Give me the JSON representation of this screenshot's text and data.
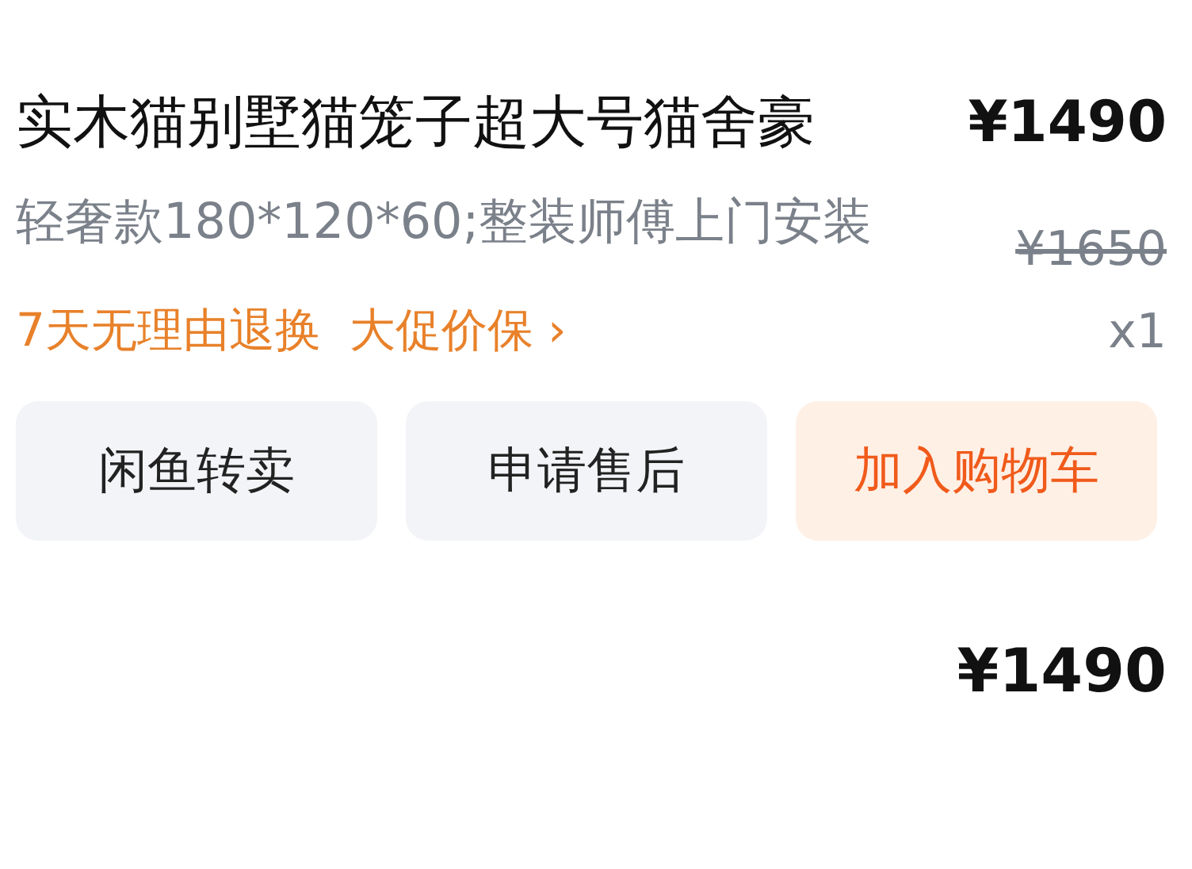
{
  "product": {
    "title": "实木猫别墅猫笼子超大号猫舍豪",
    "price": "¥1490",
    "spec": "轻奢款180*120*60;整装师傅上门安装",
    "original_price": "¥1650",
    "services": [
      "7天无理由退换",
      "大促价保"
    ],
    "services_arrow": "›",
    "quantity": "x1"
  },
  "buttons": [
    {
      "label": "闲鱼转卖",
      "kind": "plain"
    },
    {
      "label": "申请售后",
      "kind": "plain"
    },
    {
      "label": "加入购物车",
      "kind": "accent"
    }
  ],
  "total": "¥1490"
}
